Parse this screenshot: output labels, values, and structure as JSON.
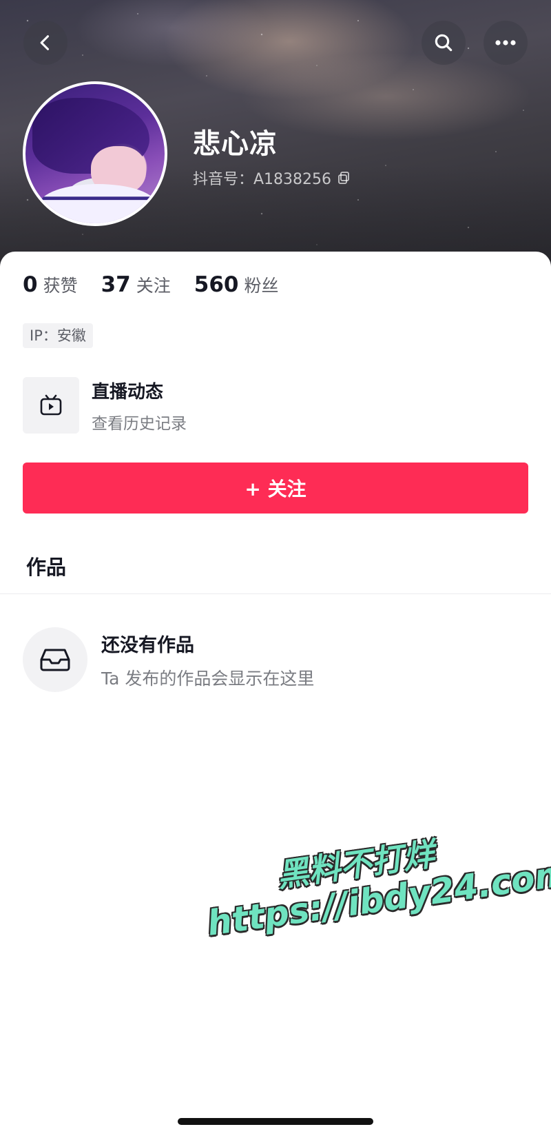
{
  "header": {
    "nickname": "悲心凉",
    "douyin_id": "抖音号：A1838256",
    "icons": {
      "back": "chevron-left-icon",
      "search": "search-icon",
      "more": "more-dots-icon",
      "copy": "copy-icon"
    }
  },
  "stats": [
    {
      "value": "0",
      "label": "获赞"
    },
    {
      "value": "37",
      "label": "关注"
    },
    {
      "value": "560",
      "label": "粉丝"
    }
  ],
  "ip_tag": "IP：安徽",
  "live": {
    "title": "直播动态",
    "subtitle": "查看历史记录",
    "icon": "tv-play-icon"
  },
  "follow_button": {
    "label": "+ 关注",
    "color": "#fe2c55"
  },
  "works_tab": "作品",
  "empty_state": {
    "title": "还没有作品",
    "subtitle": "Ta 发布的作品会显示在这里",
    "icon": "inbox-tray-icon"
  },
  "watermark": {
    "line1": "黑料不打烊",
    "line2": "https://ibdy24.com",
    "color": "#6fe3c0"
  }
}
